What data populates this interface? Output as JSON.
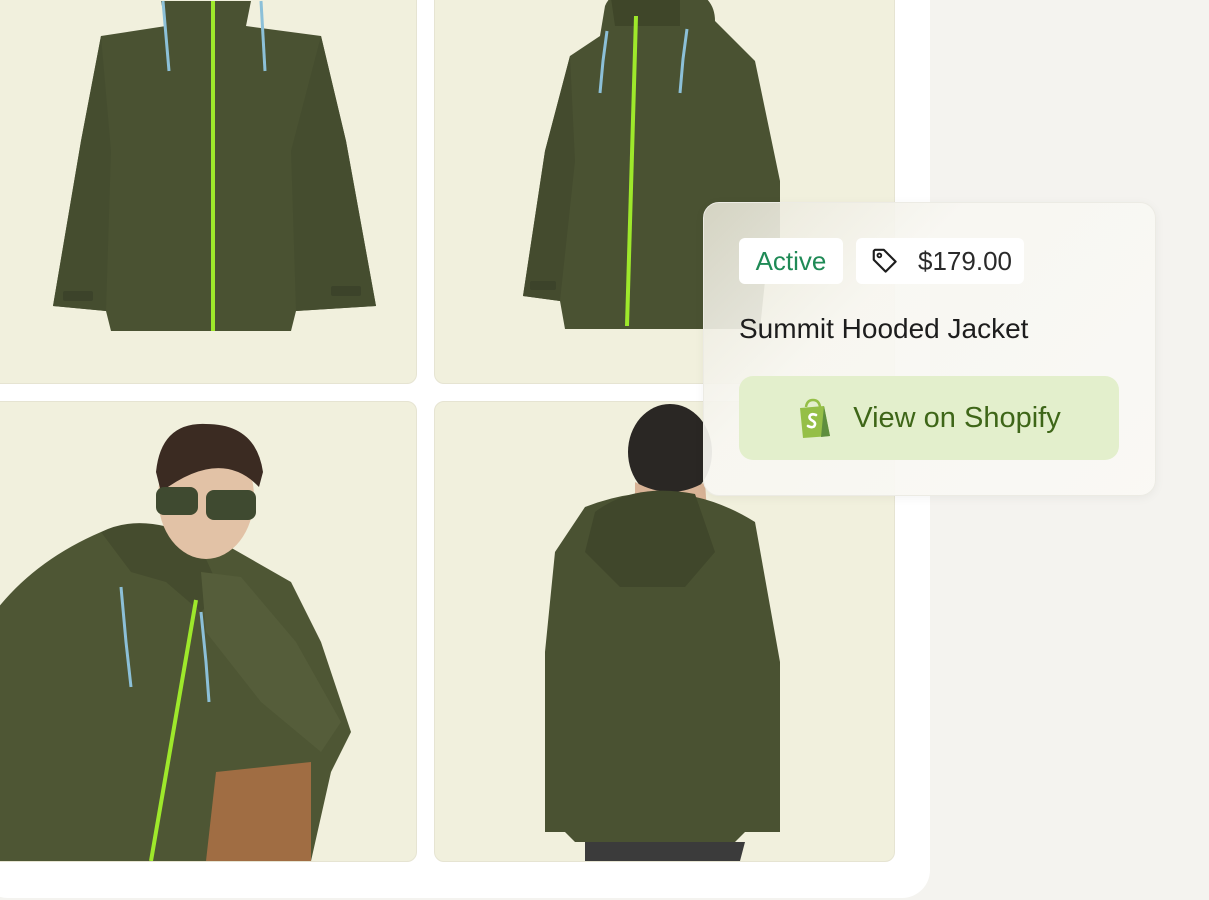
{
  "colors": {
    "background": "#f4f3ef",
    "tile": "#f1f0dd",
    "jacket": "#4a5232",
    "zipper": "#9ee82b",
    "status_text": "#1f8a56",
    "button_bg": "#e3efcc",
    "button_text": "#3e6618",
    "shopify_green": "#95bf47"
  },
  "gallery": {
    "images": [
      {
        "name": "jacket-front"
      },
      {
        "name": "jacket-three-quarter"
      },
      {
        "name": "model-seated-side"
      },
      {
        "name": "model-back"
      }
    ]
  },
  "product_card": {
    "status": "Active",
    "price_icon": "tag-icon",
    "price": "$179.00",
    "title": "Summit Hooded Jacket",
    "button_icon": "shopify-bag-icon",
    "button_label": "View on Shopify"
  }
}
